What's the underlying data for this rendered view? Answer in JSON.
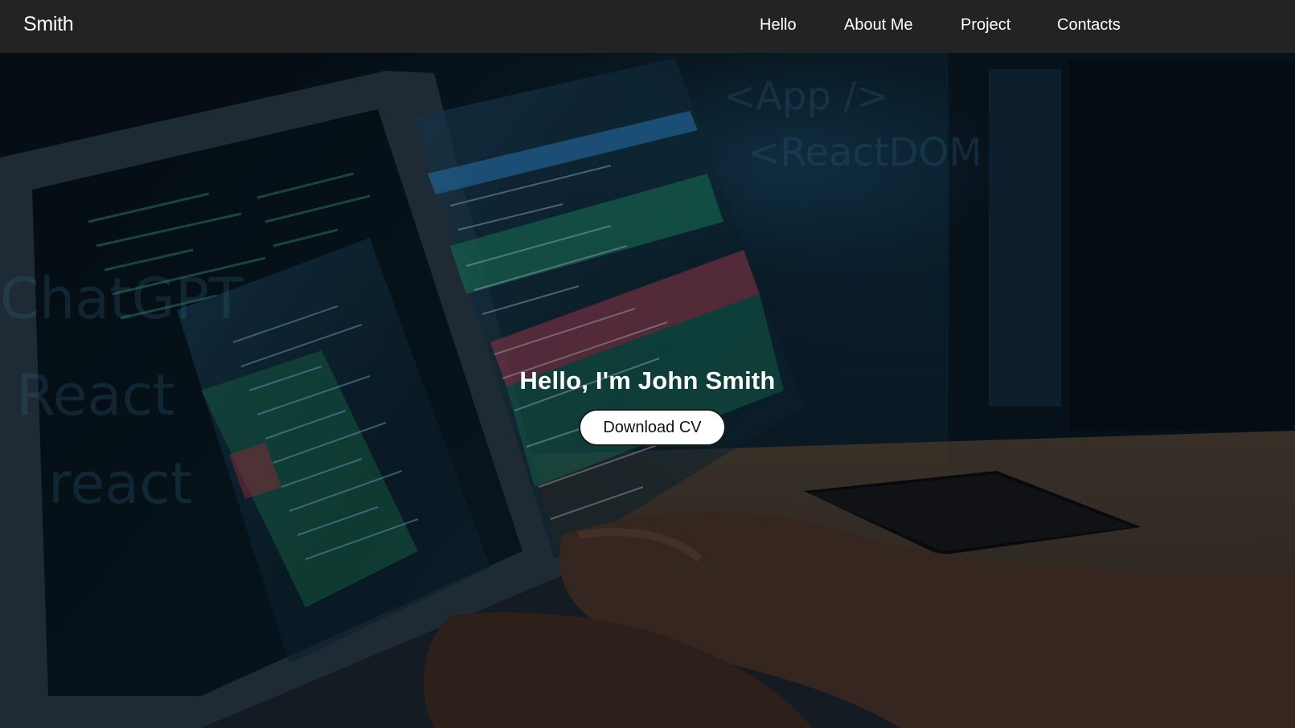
{
  "brand": {
    "name": "Smith"
  },
  "nav": {
    "items": [
      {
        "label": "Hello"
      },
      {
        "label": "About Me"
      },
      {
        "label": "Project"
      },
      {
        "label": "Contacts"
      }
    ]
  },
  "hero": {
    "title": "Hello, I'm John Smith",
    "cta_label": "Download CV",
    "background_image": "developer-typing-on-laptop-with-code-panels"
  },
  "colors": {
    "navbar_bg": "#232323",
    "nav_text": "#ffffff",
    "hero_title": "#ffffff",
    "button_bg": "#ffffff",
    "button_text": "#111111",
    "code_accent_green": "#1f9a72",
    "code_accent_blue": "#2f86c9",
    "code_accent_red": "#c4485e"
  }
}
